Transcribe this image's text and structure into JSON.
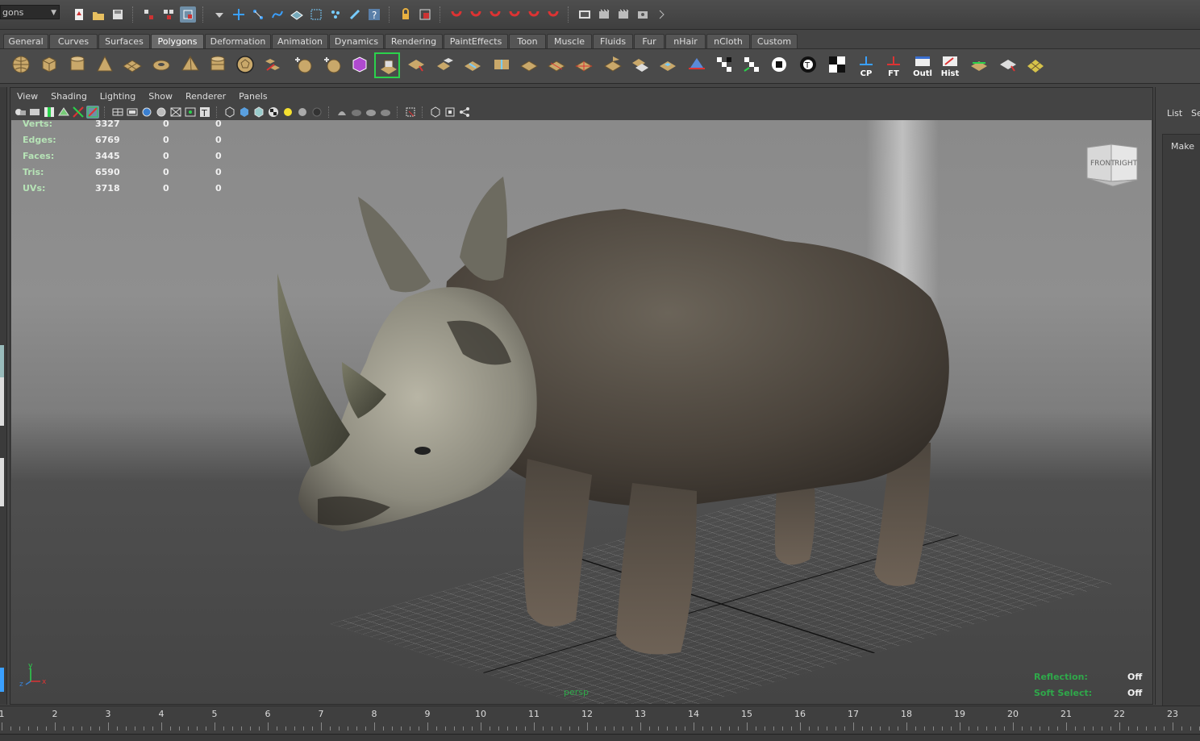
{
  "menuset": {
    "label": "gons"
  },
  "shelf_tabs": [
    {
      "label": "General",
      "active": false
    },
    {
      "label": "Curves",
      "active": false
    },
    {
      "label": "Surfaces",
      "active": false
    },
    {
      "label": "Polygons",
      "active": true
    },
    {
      "label": "Deformation",
      "active": false
    },
    {
      "label": "Animation",
      "active": false
    },
    {
      "label": "Dynamics",
      "active": false
    },
    {
      "label": "Rendering",
      "active": false
    },
    {
      "label": "PaintEffects",
      "active": false
    },
    {
      "label": "Toon",
      "active": false
    },
    {
      "label": "Muscle",
      "active": false
    },
    {
      "label": "Fluids",
      "active": false
    },
    {
      "label": "Fur",
      "active": false
    },
    {
      "label": "nHair",
      "active": false
    },
    {
      "label": "nCloth",
      "active": false
    },
    {
      "label": "Custom",
      "active": false
    }
  ],
  "shelf_labels": {
    "cp": "CP",
    "ft": "FT",
    "outl": "Outl",
    "hist": "Hist"
  },
  "panel_menu": [
    "View",
    "Shading",
    "Lighting",
    "Show",
    "Renderer",
    "Panels"
  ],
  "hud": {
    "rows": [
      {
        "label": "Verts:",
        "v1": "3327",
        "v2": "0",
        "v3": "0"
      },
      {
        "label": "Edges:",
        "v1": "6769",
        "v2": "0",
        "v3": "0"
      },
      {
        "label": "Faces:",
        "v1": "3445",
        "v2": "0",
        "v3": "0"
      },
      {
        "label": "Tris:",
        "v1": "6590",
        "v2": "0",
        "v3": "0"
      },
      {
        "label": "UVs:",
        "v1": "3718",
        "v2": "0",
        "v3": "0"
      }
    ],
    "camera": "persp",
    "reflection_label": "Reflection:",
    "reflection_value": "Off",
    "soft_select_label": "Soft Select:",
    "soft_select_value": "Off"
  },
  "view_cube": {
    "front": "FRONT",
    "right": "RIGHT"
  },
  "axis": {
    "x": "x",
    "y": "y",
    "z": "z"
  },
  "right_panel": {
    "tab1": "List",
    "tab2": "Se",
    "make": "Make"
  },
  "timeline": {
    "ticks": [
      "1",
      "2",
      "3",
      "4",
      "5",
      "6",
      "7",
      "8",
      "9",
      "10",
      "11",
      "12",
      "13",
      "14",
      "15",
      "16",
      "17",
      "18",
      "19",
      "20",
      "21",
      "22",
      "23"
    ]
  },
  "colors": {
    "hud_label": "#b6e3b6",
    "hud_green": "#2fa84a",
    "accent": "#3aa0ff"
  }
}
